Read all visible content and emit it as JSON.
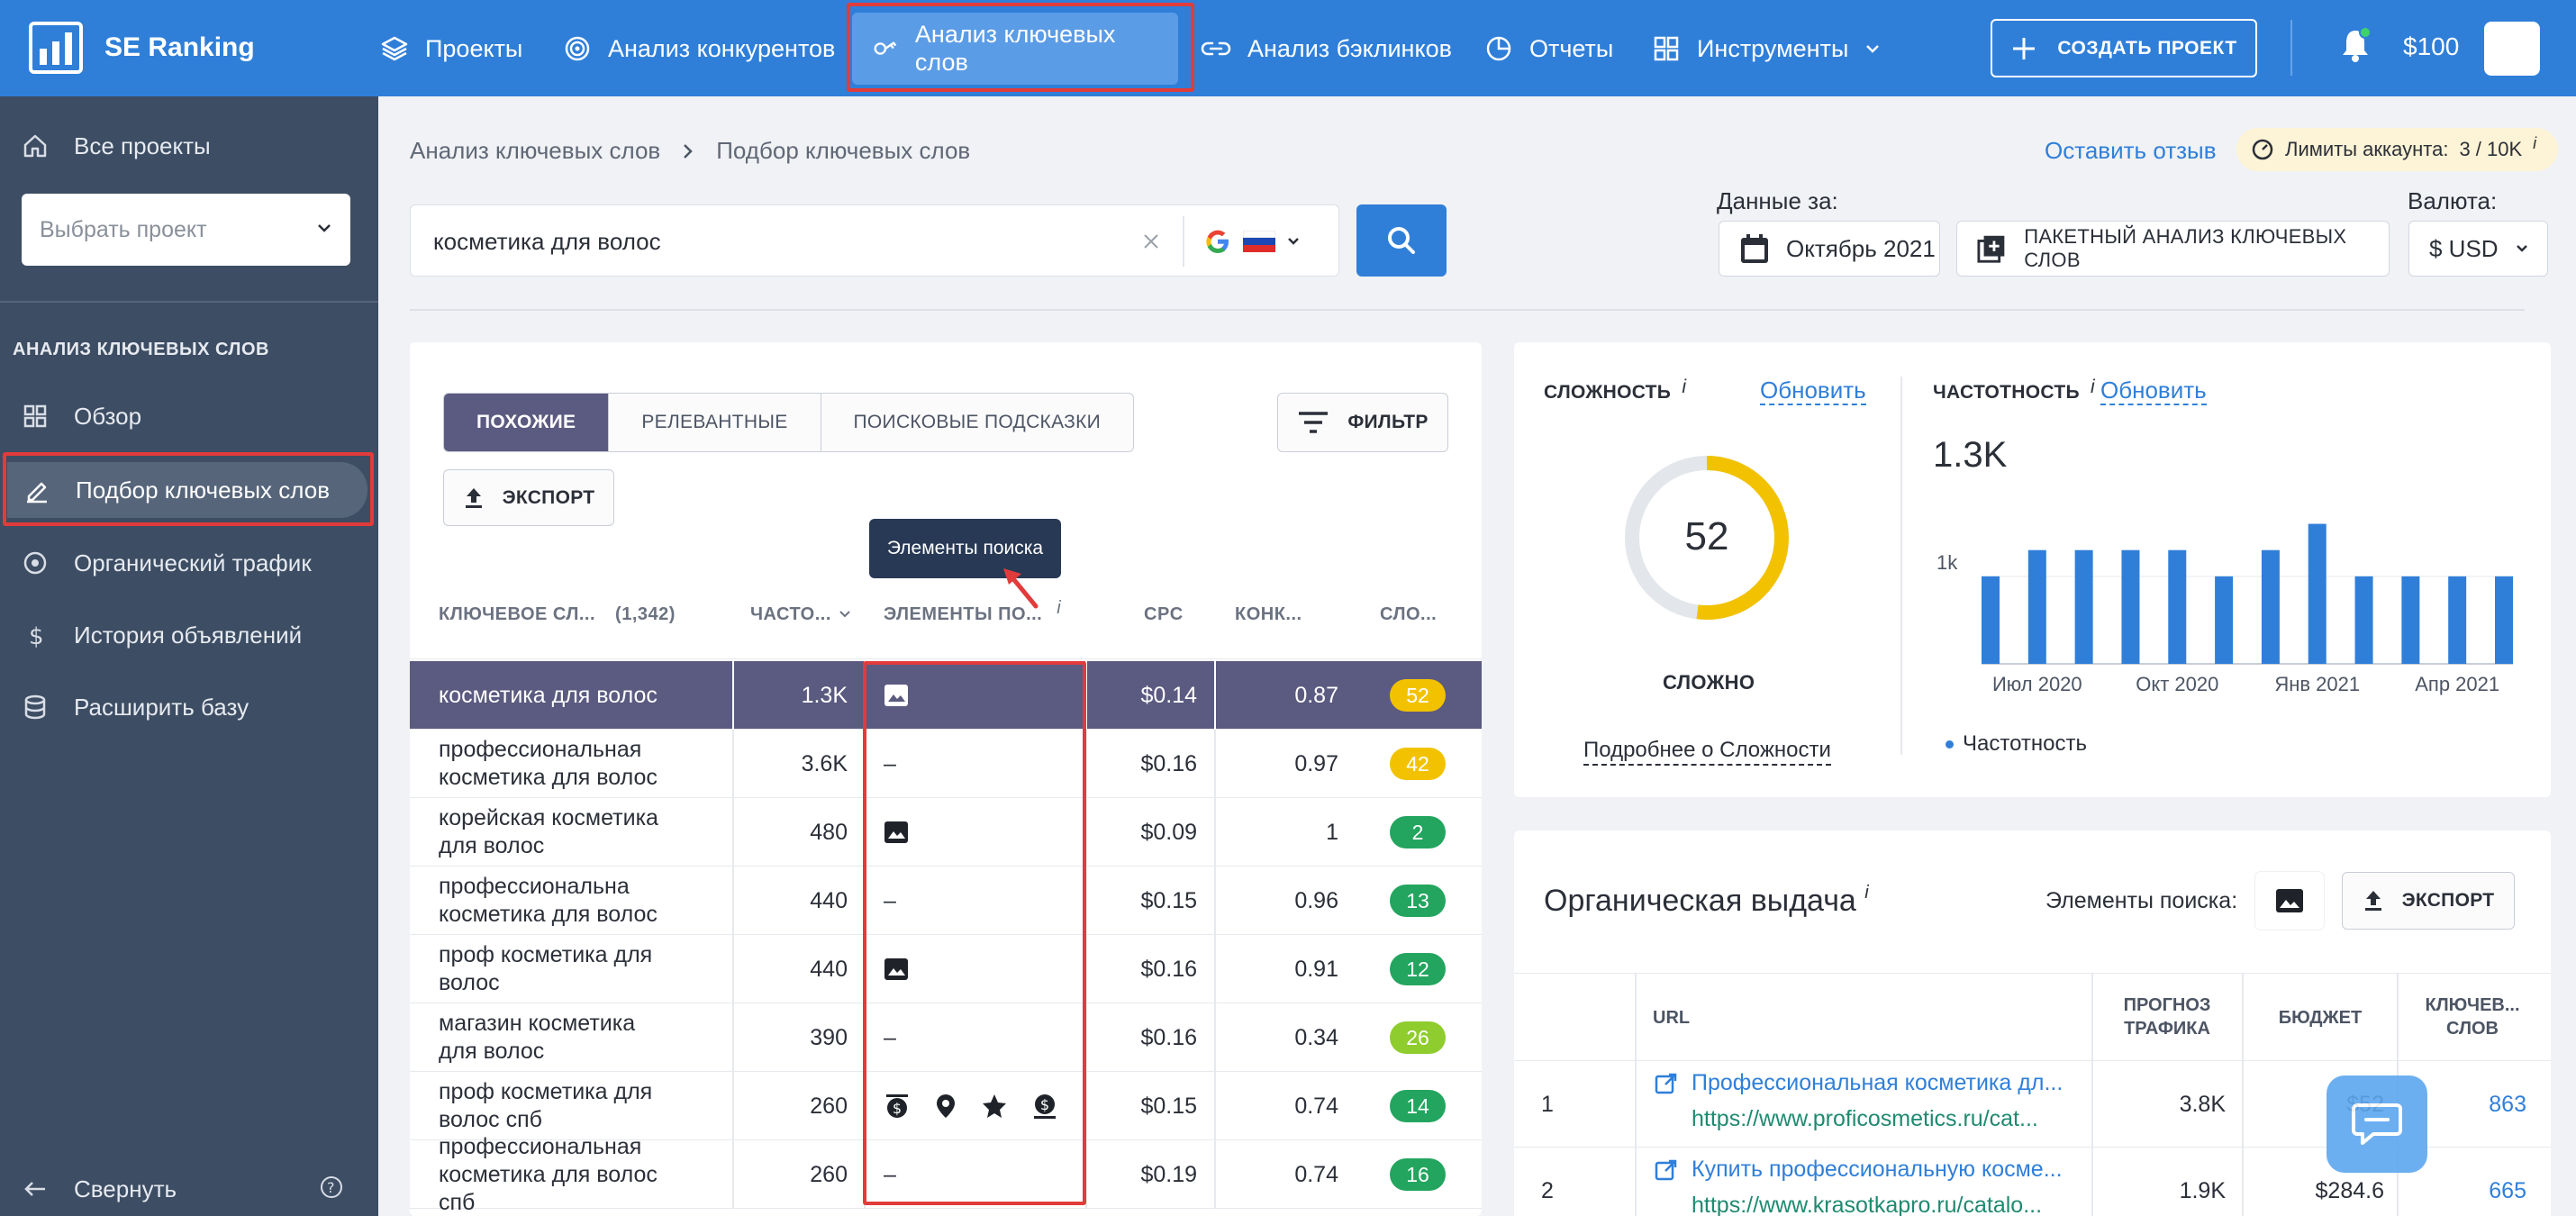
{
  "topbar": {
    "logo_text": "SE Ranking",
    "nav": [
      {
        "label": "Проекты",
        "icon": "layers-icon"
      },
      {
        "label": "Анализ конкурентов",
        "icon": "target-icon"
      },
      {
        "label": "Анализ ключевых слов",
        "icon": "key-icon",
        "active": true
      },
      {
        "label": "Анализ бэклинков",
        "icon": "link-icon"
      },
      {
        "label": "Отчеты",
        "icon": "pie-chart-icon"
      },
      {
        "label": "Инструменты",
        "icon": "grid-icon"
      }
    ],
    "create_label": "СОЗДАТЬ ПРОЕКТ",
    "balance": "$100"
  },
  "sidebar": {
    "all_projects": "Все проекты",
    "project_select_placeholder": "Выбрать проект",
    "section_heading": "АНАЛИЗ КЛЮЧЕВЫХ СЛОВ",
    "items": [
      {
        "label": "Обзор",
        "icon": "grid-icon"
      },
      {
        "label": "Подбор ключевых слов",
        "icon": "pencil-icon",
        "active": true
      },
      {
        "label": "Органический трафик",
        "icon": "target-icon"
      },
      {
        "label": "История объявлений",
        "icon": "dollar-icon"
      },
      {
        "label": "Расширить базу",
        "icon": "database-icon"
      }
    ],
    "collapse_label": "Свернуть"
  },
  "breadcrumb": {
    "parent": "Анализ ключевых слов",
    "current": "Подбор ключевых слов"
  },
  "feedback_link": "Оставить отзыв",
  "limits": {
    "label": "Лимиты аккаунта:",
    "value": "3 / 10K",
    "info": "i"
  },
  "search": {
    "value": "косметика для волос"
  },
  "data_for": {
    "label": "Данные за:",
    "value": "Октябрь 2021"
  },
  "bulk_analysis_label": "ПАКЕТНЫЙ АНАЛИЗ КЛЮЧЕВЫХ СЛОВ",
  "currency": {
    "label": "Валюта:",
    "value": "$ USD"
  },
  "tabs": [
    "ПОХОЖИЕ",
    "РЕЛЕВАНТНЫЕ",
    "ПОИСКОВЫЕ ПОДСКАЗКИ"
  ],
  "filter_label": "ФИЛЬТР",
  "export_label": "ЭКСПОРТ",
  "tooltip": "Элементы поиска",
  "table": {
    "headers": {
      "keyword": "КЛЮЧЕВОЕ СЛ...",
      "count": "(1,342)",
      "volume": "ЧАСТО...",
      "serp": "ЭЛЕМЕНТЫ ПО...",
      "cpc": "CPC",
      "comp": "КОНК...",
      "kd": "СЛО..."
    },
    "rows": [
      {
        "keyword": "косметика для волос",
        "volume": "1.3K",
        "serp": [
          "image"
        ],
        "cpc": "$0.14",
        "comp": "0.87",
        "kd": "52",
        "kd_color": "#f2c200"
      },
      {
        "keyword": "профессиональная косметика для волос",
        "volume": "3.6K",
        "serp": [],
        "cpc": "$0.16",
        "comp": "0.97",
        "kd": "42",
        "kd_color": "#f2c200"
      },
      {
        "keyword": "корейская косметика для волос",
        "volume": "480",
        "serp": [
          "image"
        ],
        "cpc": "$0.09",
        "comp": "1",
        "kd": "2",
        "kd_color": "#23a55f"
      },
      {
        "keyword": "профессиональна косметика для волос",
        "volume": "440",
        "serp": [],
        "cpc": "$0.15",
        "comp": "0.96",
        "kd": "13",
        "kd_color": "#23a55f"
      },
      {
        "keyword": "проф косметика для волос",
        "volume": "440",
        "serp": [
          "image"
        ],
        "cpc": "$0.16",
        "comp": "0.91",
        "kd": "12",
        "kd_color": "#23a55f"
      },
      {
        "keyword": "магазин косметика для волос",
        "volume": "390",
        "serp": [],
        "cpc": "$0.16",
        "comp": "0.34",
        "kd": "26",
        "kd_color": "#8fcc2e"
      },
      {
        "keyword": "проф косметика для волос спб",
        "volume": "260",
        "serp": [
          "ad",
          "map",
          "star",
          "ad2"
        ],
        "cpc": "$0.15",
        "comp": "0.74",
        "kd": "14",
        "kd_color": "#23a55f"
      },
      {
        "keyword": "профессиональная косметика для волос спб",
        "volume": "260",
        "serp": [],
        "cpc": "$0.19",
        "comp": "0.74",
        "kd": "16",
        "kd_color": "#23a55f"
      }
    ],
    "dash": "–"
  },
  "difficulty": {
    "title": "СЛОЖНОСТЬ",
    "refresh": "Обновить",
    "value": 52,
    "label": "СЛОЖНО",
    "more_link": "Подробнее о Сложности"
  },
  "volume_card": {
    "title": "ЧАСТОТНОСТЬ",
    "refresh": "Обновить",
    "value": "1.3K",
    "legend": "Частотность"
  },
  "chart_data": {
    "type": "bar",
    "ytick": "1k",
    "xtick_labels": [
      "Июл 2020",
      "Окт 2020",
      "Янв 2021",
      "Апр 2021"
    ],
    "values": [
      1000,
      1300,
      1300,
      1300,
      1300,
      1000,
      1300,
      1600,
      1000,
      1000,
      1000,
      1000
    ],
    "series": [
      {
        "name": "Частотность",
        "color": "#2f7fd9"
      }
    ]
  },
  "organic": {
    "title": "Органическая выдача",
    "serp_label": "Элементы поиска:",
    "export_label": "ЭКСПОРТ",
    "headers": {
      "url": "URL",
      "traffic": "ПРОГНОЗ ТРАФИКА",
      "budget": "БЮДЖЕТ",
      "keywords": "КЛЮЧЕВ... СЛОВ"
    },
    "rows": [
      {
        "pos": "1",
        "title": "Профессиональная косметика дл...",
        "url": "https://www.proficosmetics.ru/cat...",
        "traffic": "3.8K",
        "budget": "$52",
        "keywords": "863"
      },
      {
        "pos": "2",
        "title": "Купить профессиональную косме...",
        "url": "https://www.krasotkapro.ru/catalo...",
        "traffic": "1.9K",
        "budget": "$284.6",
        "keywords": "665"
      }
    ]
  }
}
